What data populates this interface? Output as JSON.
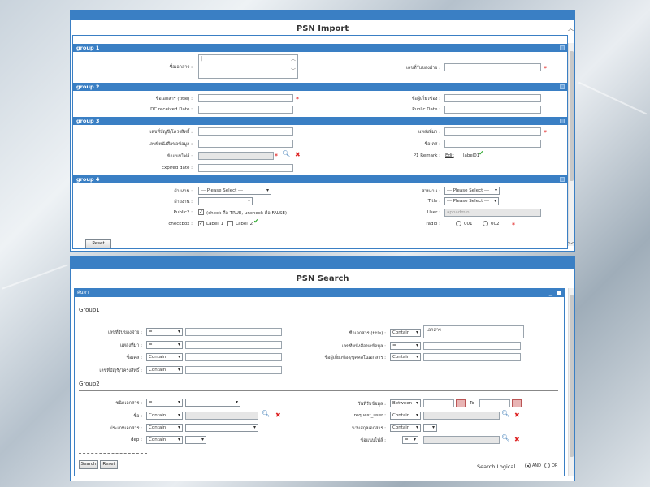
{
  "import": {
    "title": "PSN Import",
    "group1": {
      "label": "group 1",
      "doc_name_label": "ชื่อเอกสาร :",
      "doc_name_value": "|",
      "agency_no_label": "เลขที่รับของฝ่าย :"
    },
    "group2": {
      "label": "group 2",
      "doc_title_label": "ชื่อเอกสาร (title) :",
      "related_label": "ชื่อผู้เกี่ยวข้อง :",
      "dc_received_label": "DC received Date :",
      "public_date_label": "Public Date :"
    },
    "group3": {
      "label": "group 3",
      "account_label": "เลขที่บัญชี/โครงสิทธิ์ :",
      "source_label": "แหล่งที่มา :",
      "book_no_label": "เลขที่หนังสือขอข้อมูล :",
      "keyword_label": "ชื่อเคส :",
      "attach_label": "ข้อแนบไฟล์ :",
      "p1_remark_label": "P1 Remark :",
      "edit_link": "Edit",
      "label01": "label01",
      "expired_label": "Expired date :"
    },
    "group4": {
      "label": "group 4",
      "dept_label": "ฝ่ายงาน :",
      "dept_value": "--- Please Select ---",
      "line_label": "สายงาน :",
      "line_value": "--- Please Select ---",
      "branch_label": "ฝ่ายงาน :",
      "title_label": "Title :",
      "title_value": "--- Please Select ---",
      "public_label": "Public2 :",
      "public_text": "(check คือ TRUE, uncheck คือ FALSE)",
      "user_label": "User :",
      "user_value": "appadmin",
      "checkbox_label": "checkbox :",
      "label_1": "Label_1",
      "label_2": "Label_2",
      "radio_label": "radio :",
      "radio_001": "001",
      "radio_002": "002"
    },
    "reset": "Reset"
  },
  "search": {
    "title": "PSN Search",
    "panel_title": "ค้นหา",
    "group1": "Group1",
    "group2": "Group2",
    "rows_left": [
      {
        "label": "เลขที่รับของฝ่าย :",
        "op": "="
      },
      {
        "label": "แหล่งที่มา :",
        "op": "="
      },
      {
        "label": "ชื่อเคส :",
        "op": "Contain"
      },
      {
        "label": "เลขที่บัญชี/โครงสิทธิ์ :",
        "op": "Contain"
      }
    ],
    "rows_right": [
      {
        "label": "ชื่อเอกสาร (title) :",
        "op": "Contain",
        "value": "เอกสาร"
      },
      {
        "label": "เลขที่หนังสือขอข้อมูล :",
        "op": "="
      },
      {
        "label": "ชื่อผู้เกี่ยวข้อง/บุคคลในเอกสาร :",
        "op": "Contain"
      }
    ],
    "g2_left": [
      {
        "label": "ชนิดเอกสาร :",
        "op": "="
      },
      {
        "label": "ชื่อ :",
        "op": "Contain"
      },
      {
        "label": "ประเภทเอกสาร :",
        "op": "Contain"
      },
      {
        "label": "dep :",
        "op": "Contain"
      }
    ],
    "g2_right": [
      {
        "label": "วันที่รับข้อมูล :",
        "op": "Between",
        "to": "To"
      },
      {
        "label": "request_user :",
        "op": "Contain"
      },
      {
        "label": "นามสกุลเอกสาร :",
        "op": "Contain"
      },
      {
        "label": "ข้อแนบไฟล์ :",
        "op": "="
      }
    ],
    "search_btn": "Search",
    "reset_btn": "Reset",
    "logical_label": "Search Logical :",
    "and": "AND",
    "or": "OR"
  }
}
